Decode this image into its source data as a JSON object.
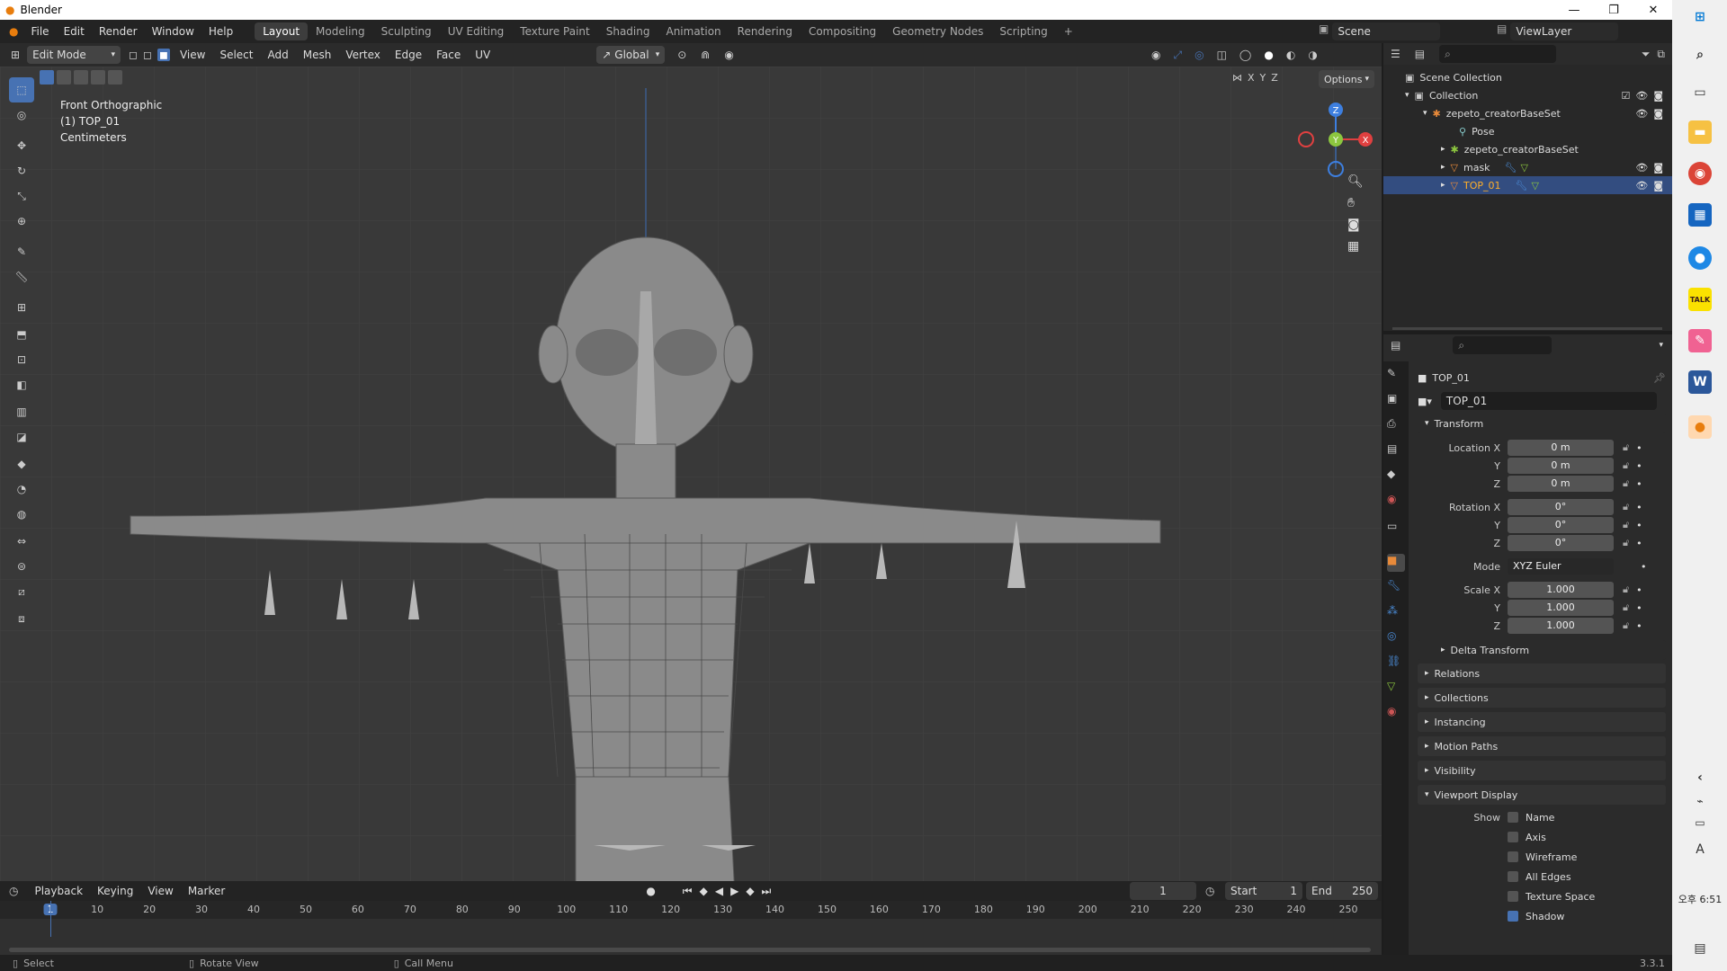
{
  "window": {
    "title": "Blender",
    "minimize": "—",
    "restore": "❐",
    "close": "✕"
  },
  "menubar": {
    "items": [
      "File",
      "Edit",
      "Render",
      "Window",
      "Help"
    ],
    "workspaces": [
      "Layout",
      "Modeling",
      "Sculpting",
      "UV Editing",
      "Texture Paint",
      "Shading",
      "Animation",
      "Rendering",
      "Compositing",
      "Geometry Nodes",
      "Scripting"
    ],
    "active_workspace": "Layout",
    "add_workspace": "+",
    "scene": "Scene",
    "view_layer": "ViewLayer"
  },
  "viewport_header": {
    "mode": "Edit Mode",
    "menus": [
      "View",
      "Select",
      "Add",
      "Mesh",
      "Vertex",
      "Edge",
      "Face",
      "UV"
    ],
    "orientation": "Global",
    "axes": [
      "X",
      "Y",
      "Z"
    ],
    "options": "Options"
  },
  "viewport": {
    "view_name": "Front Orthographic",
    "object_name": "(1) TOP_01",
    "units": "Centimeters",
    "gizmo_axes": {
      "z": "Z",
      "y": "Y",
      "x": "X"
    }
  },
  "toolbar_tools": [
    {
      "name": "select-box-tool",
      "active": true
    },
    {
      "name": "cursor-tool"
    },
    {
      "name": "move-tool"
    },
    {
      "name": "rotate-tool"
    },
    {
      "name": "scale-tool"
    },
    {
      "name": "transform-tool"
    },
    {
      "name": "annotate-tool"
    },
    {
      "name": "measure-tool"
    },
    {
      "name": "add-cube-tool"
    },
    {
      "name": "extrude-tool"
    },
    {
      "name": "inset-tool"
    },
    {
      "name": "bevel-tool"
    },
    {
      "name": "loop-cut-tool"
    },
    {
      "name": "knife-tool"
    },
    {
      "name": "poly-build-tool"
    },
    {
      "name": "spin-tool"
    },
    {
      "name": "smooth-tool"
    },
    {
      "name": "edge-slide-tool"
    },
    {
      "name": "shrink-fatten-tool"
    },
    {
      "name": "shear-tool"
    },
    {
      "name": "rip-region-tool"
    }
  ],
  "timeline": {
    "menus": [
      "Playback",
      "Keying",
      "View",
      "Marker"
    ],
    "current_frame": "1",
    "start_label": "Start",
    "start": "1",
    "end_label": "End",
    "end": "250",
    "ticks": [
      "1",
      "10",
      "20",
      "30",
      "40",
      "50",
      "60",
      "70",
      "80",
      "90",
      "100",
      "110",
      "120",
      "130",
      "140",
      "150",
      "160",
      "170",
      "180",
      "190",
      "200",
      "210",
      "220",
      "230",
      "240",
      "250"
    ]
  },
  "status_bar": {
    "items": [
      "Select",
      "Rotate View",
      "Call Menu"
    ],
    "version": "3.3.1"
  },
  "outliner": {
    "rows": [
      {
        "label": "Scene Collection",
        "icon": "scene-collection-icon"
      },
      {
        "label": "Collection",
        "icon": "collection-icon"
      },
      {
        "label": "zepeto_creatorBaseSet",
        "icon": "armature-icon"
      },
      {
        "label": "Pose",
        "icon": "pose-icon"
      },
      {
        "label": "zepeto_creatorBaseSet",
        "icon": "armature-data-icon"
      },
      {
        "label": "mask",
        "icon": "mesh-icon"
      },
      {
        "label": "TOP_01",
        "icon": "mesh-icon",
        "selected": true
      }
    ]
  },
  "properties": {
    "object_name": "TOP_01",
    "datablock": "TOP_01",
    "transform_header": "Transform",
    "location": {
      "label": "Location X",
      "x": "0 m",
      "y": "0 m",
      "z": "0 m"
    },
    "rotation": {
      "label": "Rotation X",
      "x": "0°",
      "y": "0°",
      "z": "0°"
    },
    "mode_label": "Mode",
    "mode_value": "XYZ Euler",
    "scale": {
      "label": "Scale X",
      "x": "1.000",
      "y": "1.000",
      "z": "1.000"
    },
    "axis_y": "Y",
    "axis_z": "Z",
    "delta_transform": "Delta Transform",
    "panels": [
      "Relations",
      "Collections",
      "Instancing",
      "Motion Paths",
      "Visibility"
    ],
    "viewport_display": "Viewport Display",
    "show_label": "Show",
    "show_items": [
      {
        "label": "Name",
        "checked": false
      },
      {
        "label": "Axis",
        "checked": false
      },
      {
        "label": "Wireframe",
        "checked": false
      },
      {
        "label": "All Edges",
        "checked": false
      },
      {
        "label": "Texture Space",
        "checked": false
      },
      {
        "label": "Shadow",
        "checked": true
      }
    ]
  },
  "taskbar": {
    "time": "오후 6:51",
    "ime": "A"
  },
  "colors": {
    "accent": "#4772b3",
    "axis_x": "#e04040",
    "axis_y": "#8cc63f",
    "axis_z": "#3d7fe0"
  }
}
